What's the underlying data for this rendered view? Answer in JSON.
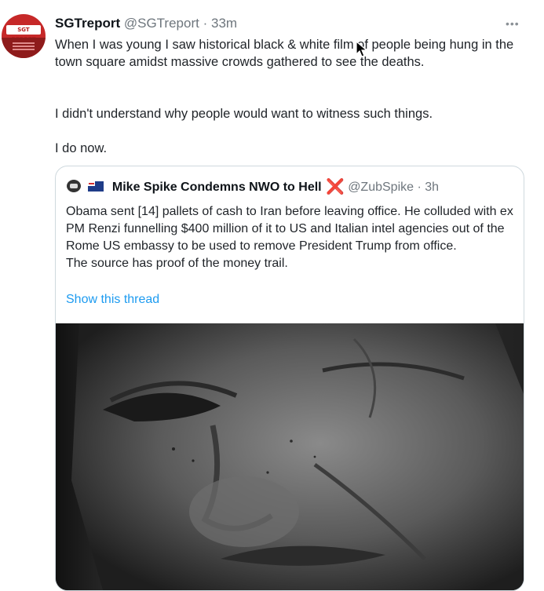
{
  "tweet": {
    "author_name": "SGTreport",
    "author_handle": "@SGTreport",
    "separator": "·",
    "time": "33m",
    "more_icon": "more-horizontal-icon",
    "avatar_label": "SGT REPORT",
    "lines": [
      "When I was young I saw historical black & white film of people being hung in the town square amidst massive crowds gathered to see the deaths.",
      "I didn't understand why people would want to witness such things.",
      "I do now."
    ]
  },
  "quoted": {
    "author_name": "Mike Spike Condemns NWO to Hell",
    "x_mark": "❌",
    "author_handle": "@ZubSpike",
    "separator": "·",
    "time": "3h",
    "flag_icon": "australia-flag-icon",
    "text": "Obama sent [14] pallets of cash to Iran before leaving office. He colluded with ex PM Renzi funnelling $400 million of it to US and Italian intel agencies out of the Rome US embassy  to be used to remove President Trump from office.\nThe source has proof of the money trail.",
    "show_thread": "Show this thread",
    "accent": "#1d9bf0"
  }
}
